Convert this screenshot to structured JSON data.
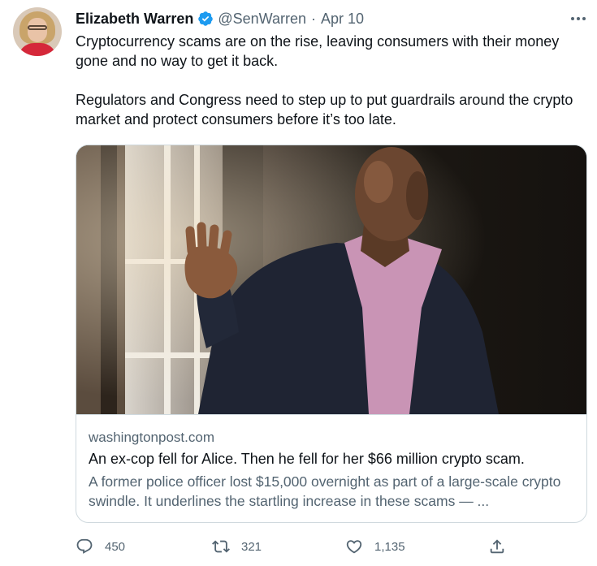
{
  "tweet": {
    "author_name": "Elizabeth Warren",
    "handle": "@SenWarren",
    "separator": "·",
    "date": "Apr 10",
    "paragraphs": [
      "Cryptocurrency scams are on the rise, leaving consumers with their money gone and no way to get it back.",
      "Regulators and Congress need to step up to put guardrails around the crypto market and protect consumers before it’s too late."
    ]
  },
  "card": {
    "domain": "washingtonpost.com",
    "title": "An ex-cop fell for Alice. Then he fell for her $66 million crypto scam.",
    "description": "A former police officer lost $15,000 overnight as part of a large-scale crypto swindle. It underlines the startling increase in these scams — ..."
  },
  "actions": {
    "replies": "450",
    "retweets": "321",
    "likes": "1,135"
  },
  "colors": {
    "text_primary": "#0f1419",
    "text_secondary": "#536471",
    "verified_blue": "#1d9bf0",
    "border": "#cfd9de"
  },
  "icons": [
    "verified-icon",
    "more-icon",
    "reply-icon",
    "retweet-icon",
    "like-icon",
    "share-icon"
  ]
}
